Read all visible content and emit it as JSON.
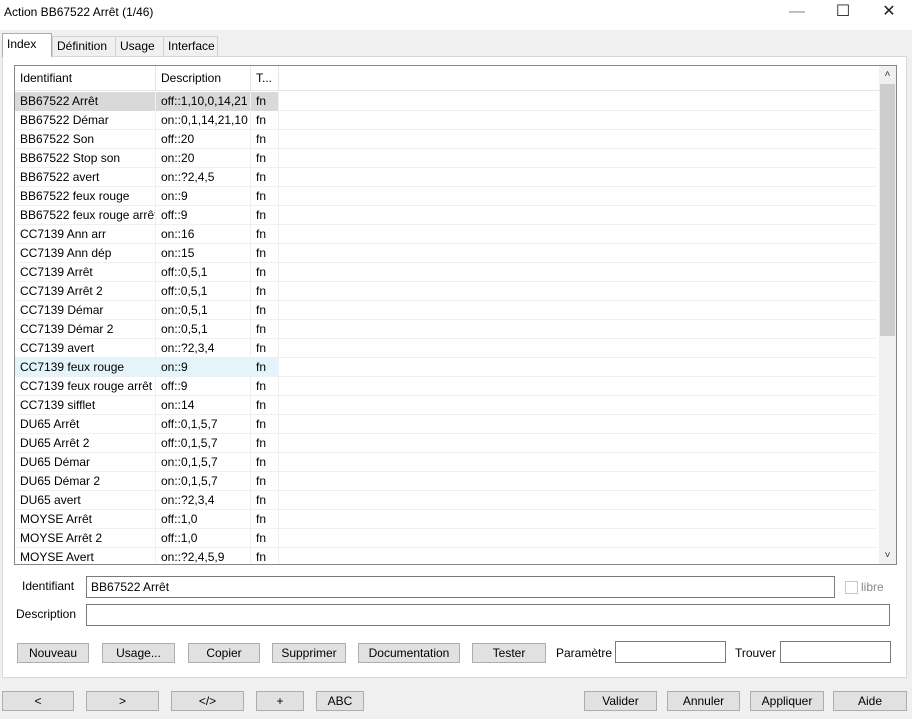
{
  "window": {
    "title": "Action BB67522 Arrêt (1/46)",
    "min_glyph": "—",
    "max_glyph": "☐",
    "close_glyph": "✕"
  },
  "tabs": [
    {
      "label": "Index"
    },
    {
      "label": "Définition"
    },
    {
      "label": "Usage"
    },
    {
      "label": "Interface"
    }
  ],
  "table": {
    "columns": [
      "Identifiant",
      "Description",
      "T..."
    ],
    "rows": [
      [
        "BB67522 Arrêt",
        "off::1,10,0,14,21",
        "fn"
      ],
      [
        "BB67522 Démar",
        "on::0,1,14,21,10",
        "fn"
      ],
      [
        "BB67522 Son",
        "off::20",
        "fn"
      ],
      [
        "BB67522 Stop son",
        "on::20",
        "fn"
      ],
      [
        "BB67522 avert",
        "on::?2,4,5",
        "fn"
      ],
      [
        "BB67522 feux rouge",
        "on::9",
        "fn"
      ],
      [
        "BB67522 feux rouge arrêt",
        "off::9",
        "fn"
      ],
      [
        "CC7139 Ann arr",
        "on::16",
        "fn"
      ],
      [
        "CC7139 Ann dép",
        "on::15",
        "fn"
      ],
      [
        "CC7139 Arrêt",
        "off::0,5,1",
        "fn"
      ],
      [
        "CC7139 Arrêt 2",
        "off::0,5,1",
        "fn"
      ],
      [
        "CC7139 Démar",
        "on::0,5,1",
        "fn"
      ],
      [
        "CC7139 Démar 2",
        "on::0,5,1",
        "fn"
      ],
      [
        "CC7139 avert",
        "on::?2,3,4",
        "fn"
      ],
      [
        "CC7139 feux rouge",
        "on::9",
        "fn"
      ],
      [
        "CC7139 feux rouge arrêt",
        "off::9",
        "fn"
      ],
      [
        "CC7139 sifflet",
        "on::14",
        "fn"
      ],
      [
        "DU65 Arrêt",
        "off::0,1,5,7",
        "fn"
      ],
      [
        "DU65 Arrêt 2",
        "off::0,1,5,7",
        "fn"
      ],
      [
        "DU65 Démar",
        "on::0,1,5,7",
        "fn"
      ],
      [
        "DU65 Démar 2",
        "on::0,1,5,7",
        "fn"
      ],
      [
        "DU65 avert",
        "on::?2,3,4",
        "fn"
      ],
      [
        "MOYSE Arrêt",
        "off::1,0",
        "fn"
      ],
      [
        "MOYSE Arrêt 2",
        "off::1,0",
        "fn"
      ],
      [
        "MOYSE Avert",
        "on::?2,4,5,9",
        "fn"
      ]
    ],
    "selected_index": 0,
    "hover_index": 14,
    "scroll_up_glyph": "˄",
    "scroll_down_glyph": "˅"
  },
  "form": {
    "identifiant_label": "Identifiant",
    "identifiant_value": "BB67522 Arrêt",
    "libre_label": "libre",
    "description_label": "Description",
    "description_value": ""
  },
  "actions": {
    "nouveau": "Nouveau",
    "usage": "Usage...",
    "copier": "Copier",
    "supprimer": "Supprimer",
    "documentation": "Documentation",
    "tester": "Tester",
    "parametre_label": "Paramètre",
    "parametre_value": "",
    "trouver_label": "Trouver",
    "trouver_value": ""
  },
  "bottom": {
    "prev": "<",
    "next": ">",
    "code": "</>",
    "add": "+",
    "abc": "ABC",
    "valider": "Valider",
    "annuler": "Annuler",
    "appliquer": "Appliquer",
    "aide": "Aide"
  }
}
